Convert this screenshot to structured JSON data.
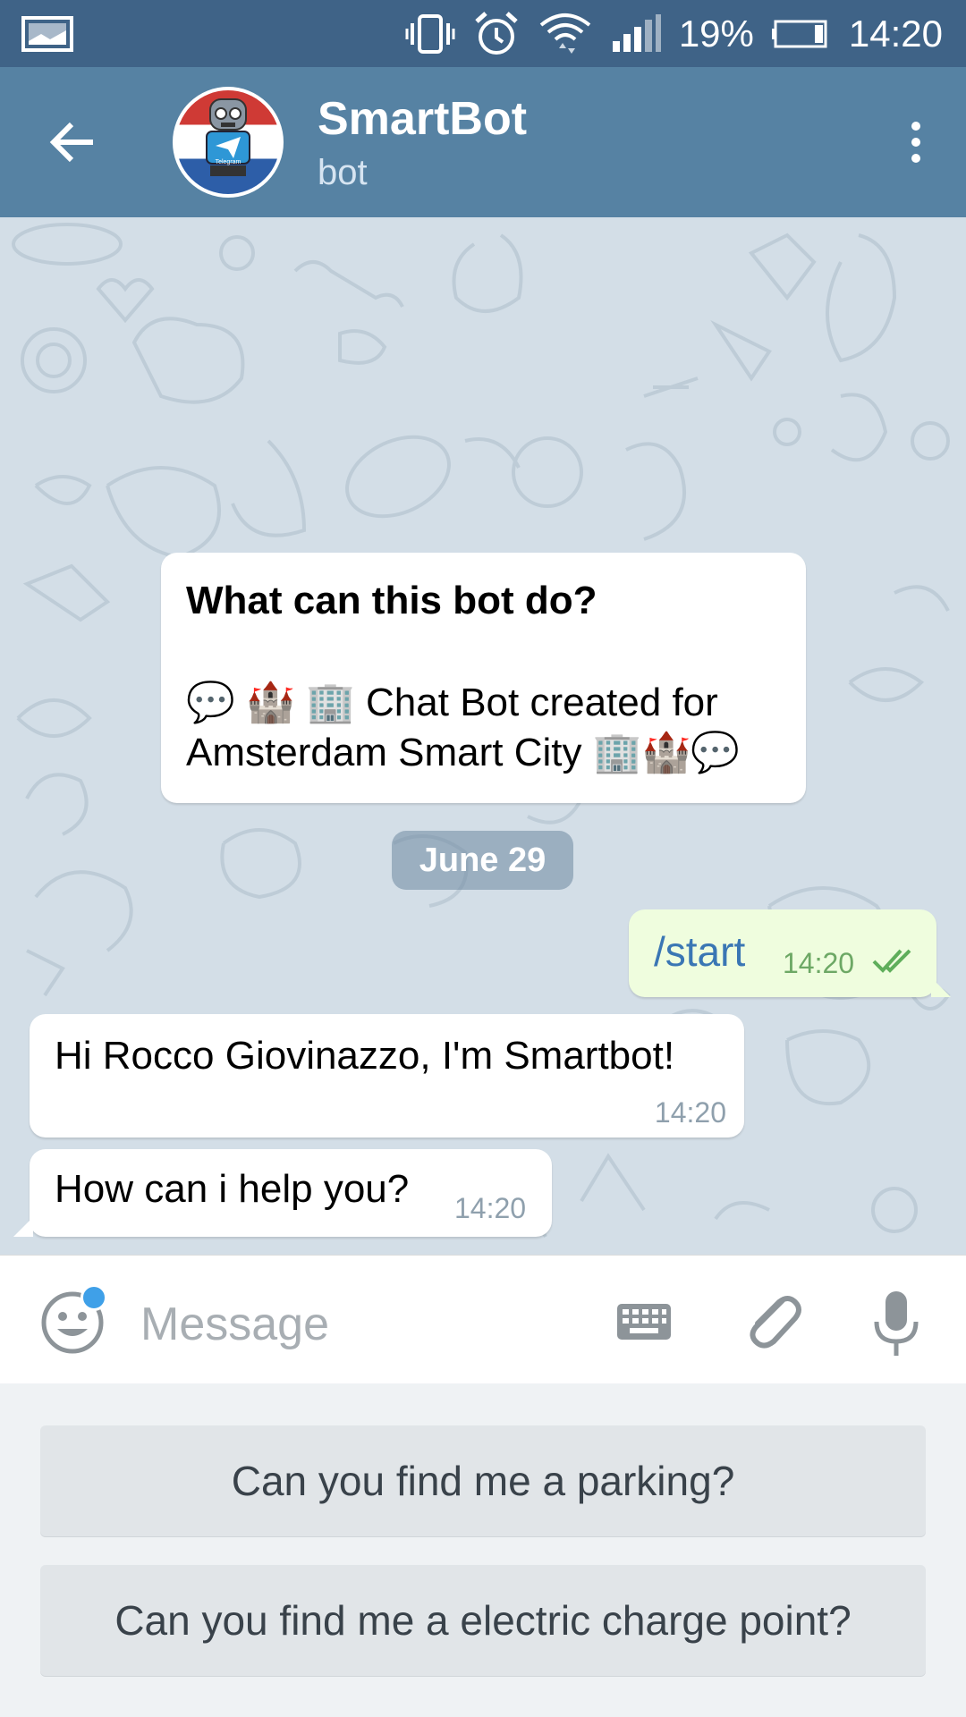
{
  "status_bar": {
    "battery": "19%",
    "time": "14:20"
  },
  "header": {
    "title": "SmartBot",
    "subtitle": "bot",
    "avatar_text": "Telegram"
  },
  "chat": {
    "info_title": "What can this bot do?",
    "info_body": "💬 🏰 🏢 Chat Bot created for Amsterdam Smart City 🏢🏰💬",
    "date_chip": "June 29",
    "messages": [
      {
        "direction": "out",
        "text": "/start",
        "time": "14:20",
        "status": "read"
      },
      {
        "direction": "in",
        "text": "Hi Rocco Giovinazzo, I'm Smartbot!",
        "time": "14:20"
      },
      {
        "direction": "in",
        "text": "How can i help you?",
        "time": "14:20"
      }
    ]
  },
  "input": {
    "placeholder": "Message"
  },
  "bot_keyboard": {
    "buttons": [
      "Can you find me a parking?",
      "Can you find me a electric charge point?"
    ]
  },
  "colors": {
    "status_bar": "#3f6387",
    "header": "#5682a3",
    "chat_background": "#d3dee7",
    "outgoing_bubble": "#effdde",
    "accent_dot": "#3fa0e8"
  }
}
